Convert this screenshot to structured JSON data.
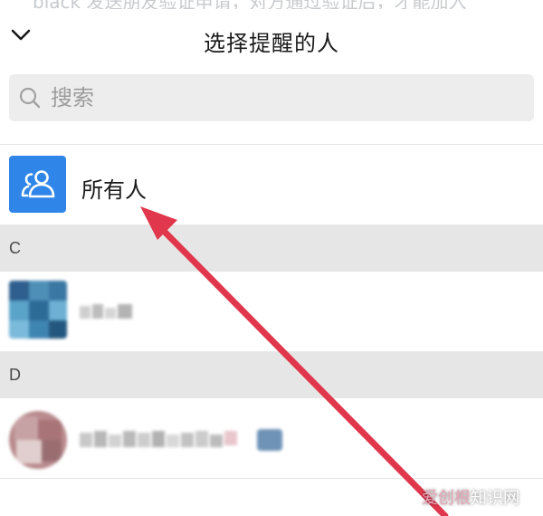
{
  "top_strip": {
    "text": "black 发送朋友验证申请，对方通过验证后，才能加入"
  },
  "header": {
    "title": "选择提醒的人",
    "collapse_icon": "chevron-down-icon"
  },
  "search": {
    "placeholder": "搜索",
    "value": "",
    "icon": "search-icon"
  },
  "everyone": {
    "label": "所有人",
    "icon": "people-icon",
    "avatar_color": "#2f86e8"
  },
  "sections": [
    {
      "letter": "C"
    },
    {
      "letter": "D"
    }
  ],
  "annotation": {
    "arrow_color": "#e0374c"
  },
  "watermark": {
    "brand": "爱创根",
    "text": "知识网"
  }
}
